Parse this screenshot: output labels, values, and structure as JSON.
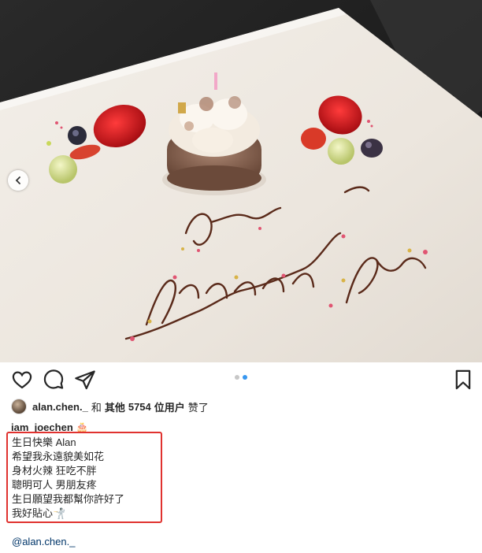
{
  "post": {
    "likes": {
      "user": "alan.chen._",
      "conjunction": "和",
      "others_label": "其他",
      "count": "5754",
      "unit_label": "位用户",
      "suffix": "赞了"
    },
    "caption": {
      "username": "iam_joechen",
      "username_emoji": "🎂",
      "lines": [
        "生日快樂 Alan",
        "希望我永遠貌美如花",
        "身材火辣 狂吃不胖",
        "聰明可人 男朋友疼",
        "生日願望我都幫你許好了",
        "我好貼心🤺"
      ]
    },
    "mention": "@alan.chen._",
    "carousel": {
      "total": 2,
      "current": 2
    }
  },
  "icons": [
    "heart-icon",
    "comment-icon",
    "share-icon",
    "bookmark-icon",
    "chevron-left-icon"
  ],
  "colors": {
    "highlight_box": "#e0322f",
    "dot_active": "#3897f0",
    "dot_inactive": "#c7c7c7",
    "chocolate_writing": "#5a2a1a"
  }
}
